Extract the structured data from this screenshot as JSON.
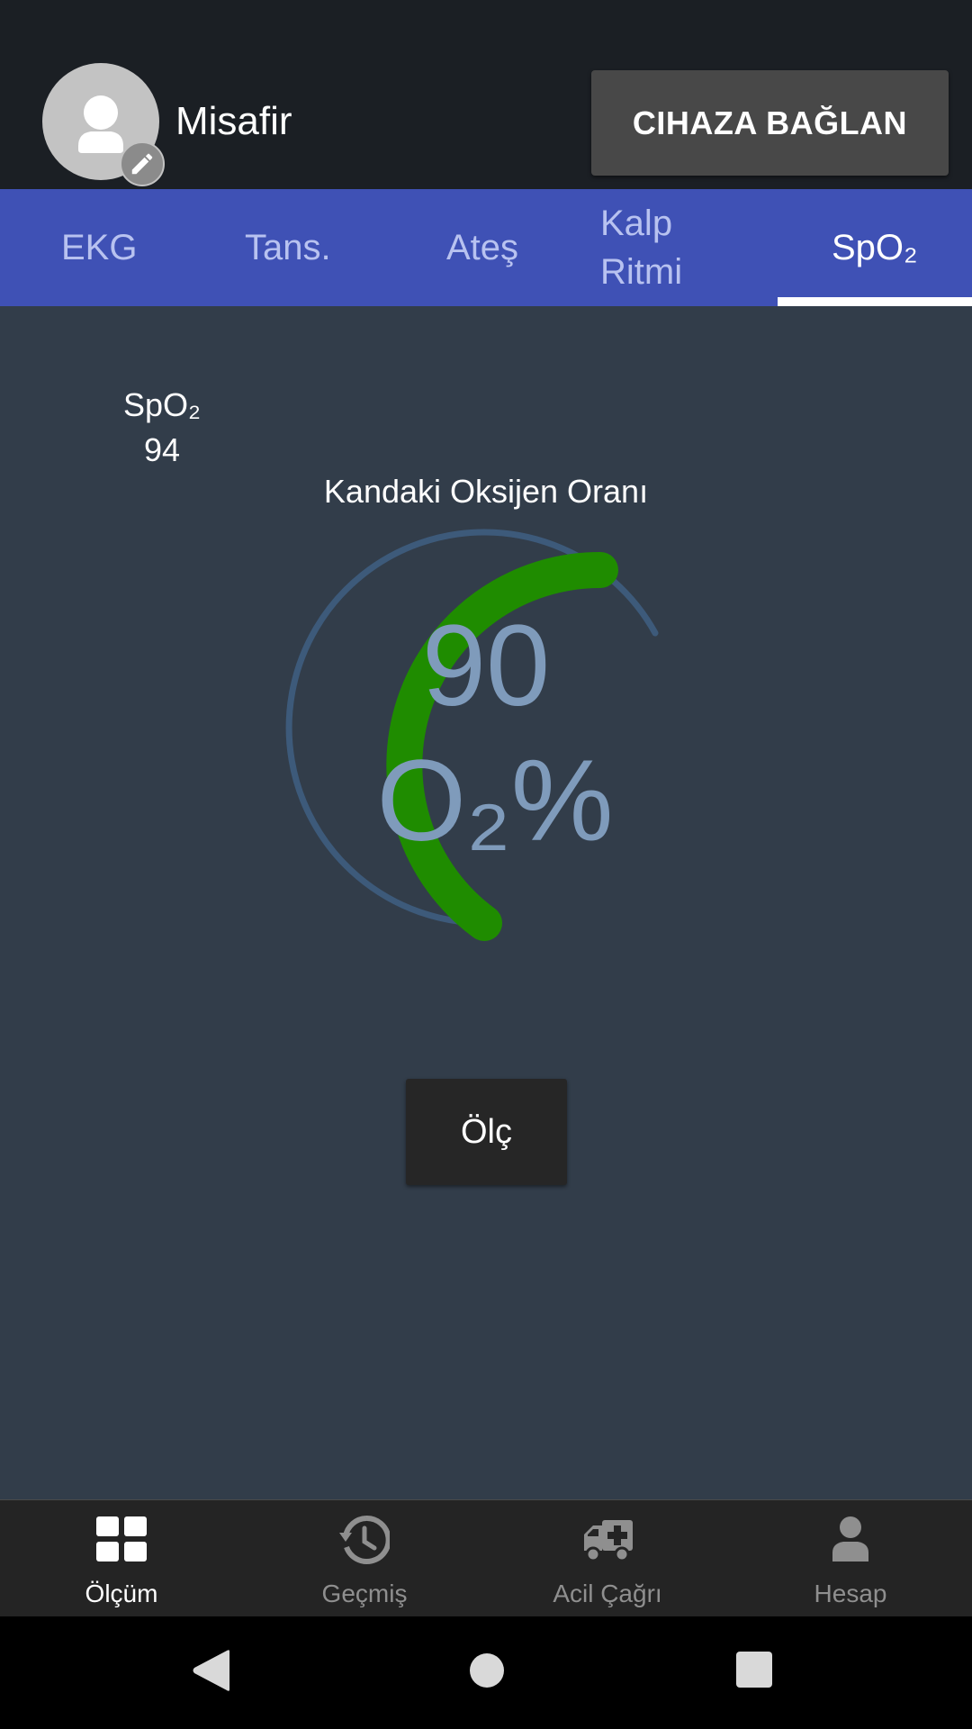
{
  "header": {
    "username": "Misafir",
    "connect_button": "CIHAZA BAĞLAN"
  },
  "tabs": [
    {
      "label": "EKG",
      "active": false
    },
    {
      "label": "Tans.",
      "active": false
    },
    {
      "label": "Ateş",
      "active": false
    },
    {
      "label": "Kalp Ritmi",
      "active": false
    },
    {
      "label": "SpO₂",
      "active": true
    }
  ],
  "mini_reading": {
    "label": "SpO₂",
    "value": "94"
  },
  "gauge": {
    "title": "Kandaki Oksijen Oranı",
    "value": "90",
    "unit": "O₂%",
    "colors": {
      "progress": "#1f8c00",
      "track": "#3d5a7a",
      "text": "#7f9bbb"
    }
  },
  "measure_button": "Ölç",
  "bottom_nav": [
    {
      "label": "Ölçüm",
      "icon": "dashboard-icon",
      "active": true
    },
    {
      "label": "Geçmiş",
      "icon": "history-icon",
      "active": false
    },
    {
      "label": "Acil Çağrı",
      "icon": "ambulance-icon",
      "active": false
    },
    {
      "label": "Hesap",
      "icon": "account-icon",
      "active": false
    }
  ],
  "system_nav": {
    "icons": [
      "back-icon",
      "home-icon",
      "recents-icon"
    ]
  }
}
